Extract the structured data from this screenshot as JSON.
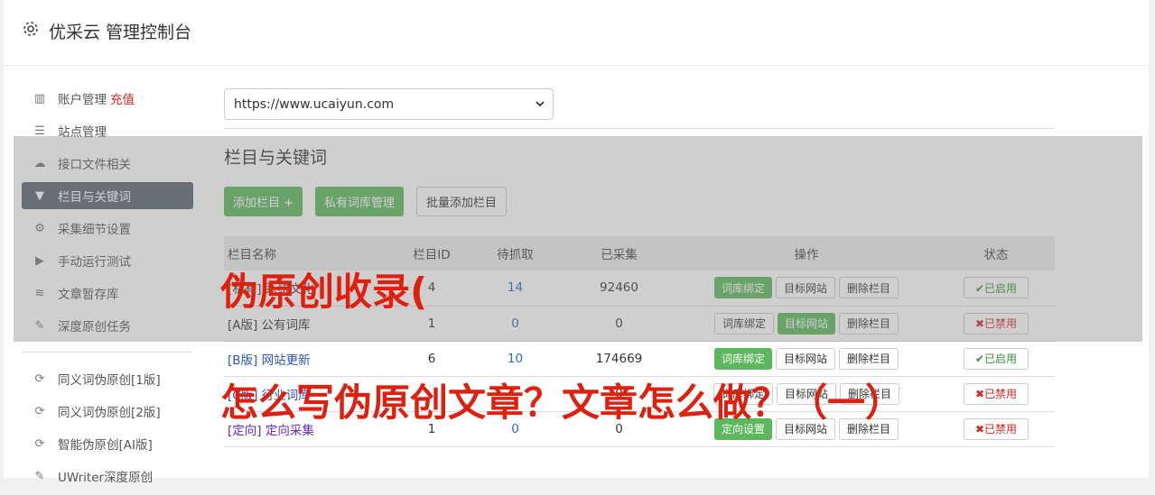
{
  "app": {
    "title": "优采云 管理控制台"
  },
  "sidebar": {
    "items": [
      {
        "label": "账户管理",
        "extra": "充值",
        "icon": "bar-chart-icon"
      },
      {
        "label": "站点管理",
        "icon": "server-icon"
      },
      {
        "label": "接口文件相关",
        "icon": "cloud-upload-icon"
      },
      {
        "label": "栏目与关键词",
        "icon": "filter-icon",
        "active": true
      },
      {
        "label": "采集细节设置",
        "icon": "gears-icon"
      },
      {
        "label": "手动运行测试",
        "icon": "play-circle-icon"
      },
      {
        "label": "文章暂存库",
        "icon": "database-icon"
      },
      {
        "label": "深度原创任务",
        "icon": "edit-icon"
      }
    ],
    "items2": [
      {
        "label": "同义词伪原创[1版]",
        "icon": "refresh-icon"
      },
      {
        "label": "同义词伪原创[2版]",
        "icon": "refresh-icon"
      },
      {
        "label": "智能伪原创[AI版]",
        "icon": "refresh-icon"
      },
      {
        "label": "UWriter深度原创",
        "icon": "edit-icon"
      }
    ]
  },
  "site_select": {
    "value": "https://www.ucaiyun.com"
  },
  "section": {
    "title": "栏目与关键词"
  },
  "buttons": {
    "add": "添加栏目 +",
    "private": "私有词库管理",
    "batch": "批量添加栏目"
  },
  "table": {
    "headers": [
      "栏目名称",
      "栏目ID",
      "待抓取",
      "已采集",
      "操作",
      "状态"
    ],
    "rows": [
      {
        "name": "[私有] 系统文化",
        "id": "4",
        "pending": "14",
        "collected": "92460",
        "op1": "词库绑定",
        "op2": "目标网站",
        "op3": "删除栏目",
        "status": "✔已启用",
        "on": true
      },
      {
        "name": "[A版] 公有词库",
        "id": "1",
        "pending": "0",
        "collected": "0",
        "op1": "词库绑定",
        "op2": "目标网站",
        "op3": "删除栏目",
        "status": "✖已禁用",
        "on": false
      },
      {
        "name": "[B版] 网站更新",
        "id": "6",
        "pending": "10",
        "collected": "174669",
        "op1": "词库绑定",
        "op2": "目标网站",
        "op3": "删除栏目",
        "status": "✔已启用",
        "on": true
      },
      {
        "name": "[C版] 行业词库",
        "id": "",
        "pending": "",
        "collected": "0",
        "op1": "词库绑定",
        "op2": "目标网站",
        "op3": "删除栏目",
        "status": "✖已禁用",
        "on": false
      },
      {
        "name": "[定向] 定向采集",
        "id": "1",
        "pending": "0",
        "collected": "0",
        "op1": "定向设置",
        "op2": "目标网站",
        "op3": "删除栏目",
        "status": "✖已禁用",
        "on": false
      }
    ]
  },
  "watermarks": {
    "line1": "伪原创收录(",
    "line2": "怎么写伪原创文章？文章怎么做？（一）"
  }
}
